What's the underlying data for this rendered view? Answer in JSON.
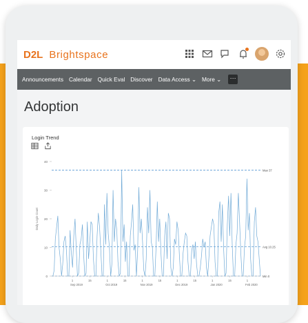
{
  "app": {
    "logo_brand": "D2L",
    "logo_product": "Brightspace"
  },
  "topbar_icons": [
    "grid-icon",
    "mail-icon",
    "chat-icon",
    "bell-icon",
    "avatar",
    "gear-icon"
  ],
  "nav": {
    "items": [
      "Announcements",
      "Calendar",
      "Quick Eval",
      "Discover",
      "Data Access ⌄",
      "More ⌄"
    ],
    "overflow_label": "···"
  },
  "page": {
    "title": "Adoption"
  },
  "chart_data": {
    "type": "line",
    "title": "Login Trend",
    "ylabel": "Daily Login Count",
    "ylim": [
      0,
      40
    ],
    "yticks": [
      "0",
      "10",
      "20",
      "30",
      "40"
    ],
    "x_day_ticks": [
      "1",
      "15",
      "1",
      "15",
      "1",
      "15",
      "1",
      "15",
      "1",
      "15",
      "1"
    ],
    "x_month_labels": [
      "Sep 2019",
      "Oct 2019",
      "Nov 2019",
      "Dec 2019",
      "Jan 2020",
      "Feb 2020"
    ],
    "reference_lines": [
      {
        "label": "Max 37",
        "value": 37
      },
      {
        "label": "Avg 10.25",
        "value": 10.25
      },
      {
        "label": "Min 0",
        "value": 0
      }
    ],
    "values": [
      0,
      0,
      2,
      13,
      17,
      21,
      10,
      6,
      0,
      4,
      12,
      14,
      9,
      0,
      0,
      16,
      8,
      3,
      14,
      20,
      10,
      0,
      1,
      11,
      13,
      18,
      8,
      0,
      1,
      19,
      6,
      12,
      19,
      18,
      6,
      0,
      0,
      14,
      22,
      17,
      9,
      0,
      0,
      25,
      11,
      29,
      15,
      10,
      0,
      4,
      30,
      12,
      20,
      16,
      5,
      0,
      1,
      37,
      12,
      18,
      5,
      12,
      0,
      0,
      14,
      19,
      25,
      9,
      11,
      0,
      9,
      31,
      15,
      20,
      12,
      2,
      0,
      6,
      24,
      15,
      30,
      12,
      10,
      0,
      0,
      10,
      26,
      12,
      20,
      8,
      0,
      0,
      14,
      19,
      6,
      22,
      20,
      3,
      0,
      3,
      13,
      11,
      19,
      16,
      7,
      0,
      0,
      8,
      12,
      15,
      14,
      5,
      0,
      0,
      9,
      11,
      6,
      12,
      4,
      0,
      0,
      3,
      7,
      13,
      10,
      12,
      3,
      0,
      6,
      14,
      17,
      20,
      18,
      5,
      0,
      0,
      22,
      26,
      12,
      25,
      10,
      0,
      1,
      18,
      28,
      14,
      29,
      11,
      0,
      0,
      11,
      15,
      29,
      19,
      8,
      0,
      0,
      10,
      14,
      34,
      16,
      22,
      6,
      0,
      0,
      19,
      24,
      14,
      12,
      6,
      0
    ],
    "line_color": "#6fa9d6",
    "ref_color": "#5b9bd5"
  }
}
